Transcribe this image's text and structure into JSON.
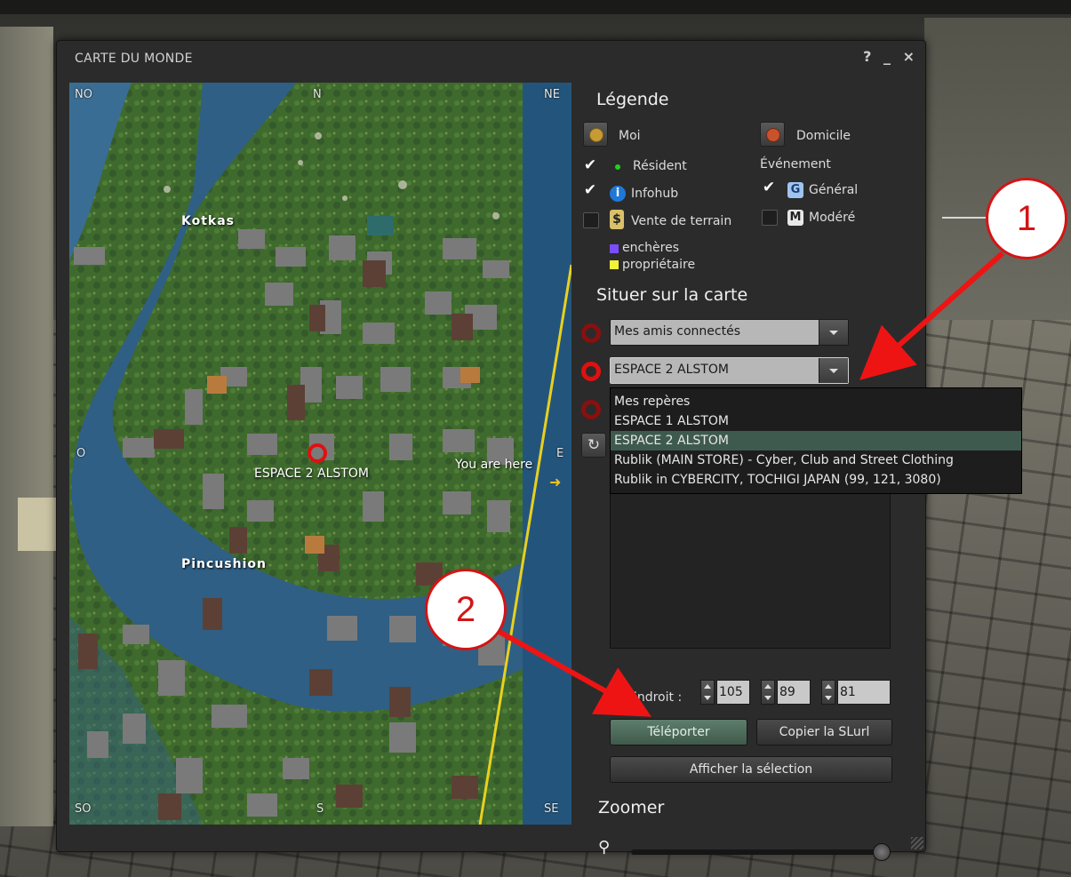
{
  "window": {
    "title": "CARTE DU MONDE",
    "help": "?",
    "minimize": "_",
    "close": "×"
  },
  "map": {
    "compass": {
      "nw": "NO",
      "n": "N",
      "ne": "NE",
      "w": "O",
      "e": "E",
      "sw": "SO",
      "s": "S",
      "se": "SE"
    },
    "regions": {
      "north": "Kotkas",
      "south": "Pincushion"
    },
    "landmark_label": "ESPACE 2 ALSTOM",
    "you_are_here": "You are here"
  },
  "legend": {
    "title": "Légende",
    "me": "Moi",
    "home": "Domicile",
    "resident": {
      "label": "Résident",
      "checked": true
    },
    "infohub": {
      "label": "Infohub",
      "checked": true
    },
    "land_sale": {
      "label": "Vente de terrain",
      "checked": false
    },
    "event_title": "Événement",
    "general": {
      "label": "Général",
      "badge": "G",
      "checked": true
    },
    "moderate": {
      "label": "Modéré",
      "badge": "M",
      "checked": false
    },
    "auction": "enchères",
    "owner": "propriétaire",
    "colors": {
      "auction": "#7a4dff",
      "owner": "#f2f23a",
      "resident_dot": "#20d020"
    }
  },
  "locate": {
    "title": "Situer sur la carte",
    "friends_combo": "Mes amis connectés",
    "landmarks_combo": "ESPACE 2 ALSTOM",
    "dropdown_items": [
      "Mes repères",
      "ESPACE 1 ALSTOM",
      "ESPACE 2 ALSTOM",
      "Rublik (MAIN STORE) - Cyber, Club and Street Clothing",
      "Rublik in  CYBERCITY, TOCHIGI JAPAN (99, 121, 3080)"
    ],
    "selected_index": 2
  },
  "location": {
    "label": "Endroit :",
    "x": "105",
    "y": "89",
    "z": "81"
  },
  "buttons": {
    "teleport": "Téléporter",
    "copy_slurl": "Copier la SLurl",
    "show_selection": "Afficher la sélection"
  },
  "zoom": {
    "title": "Zoomer",
    "level": 0.97
  },
  "annotations": {
    "callout1": "1",
    "callout2": "2"
  }
}
